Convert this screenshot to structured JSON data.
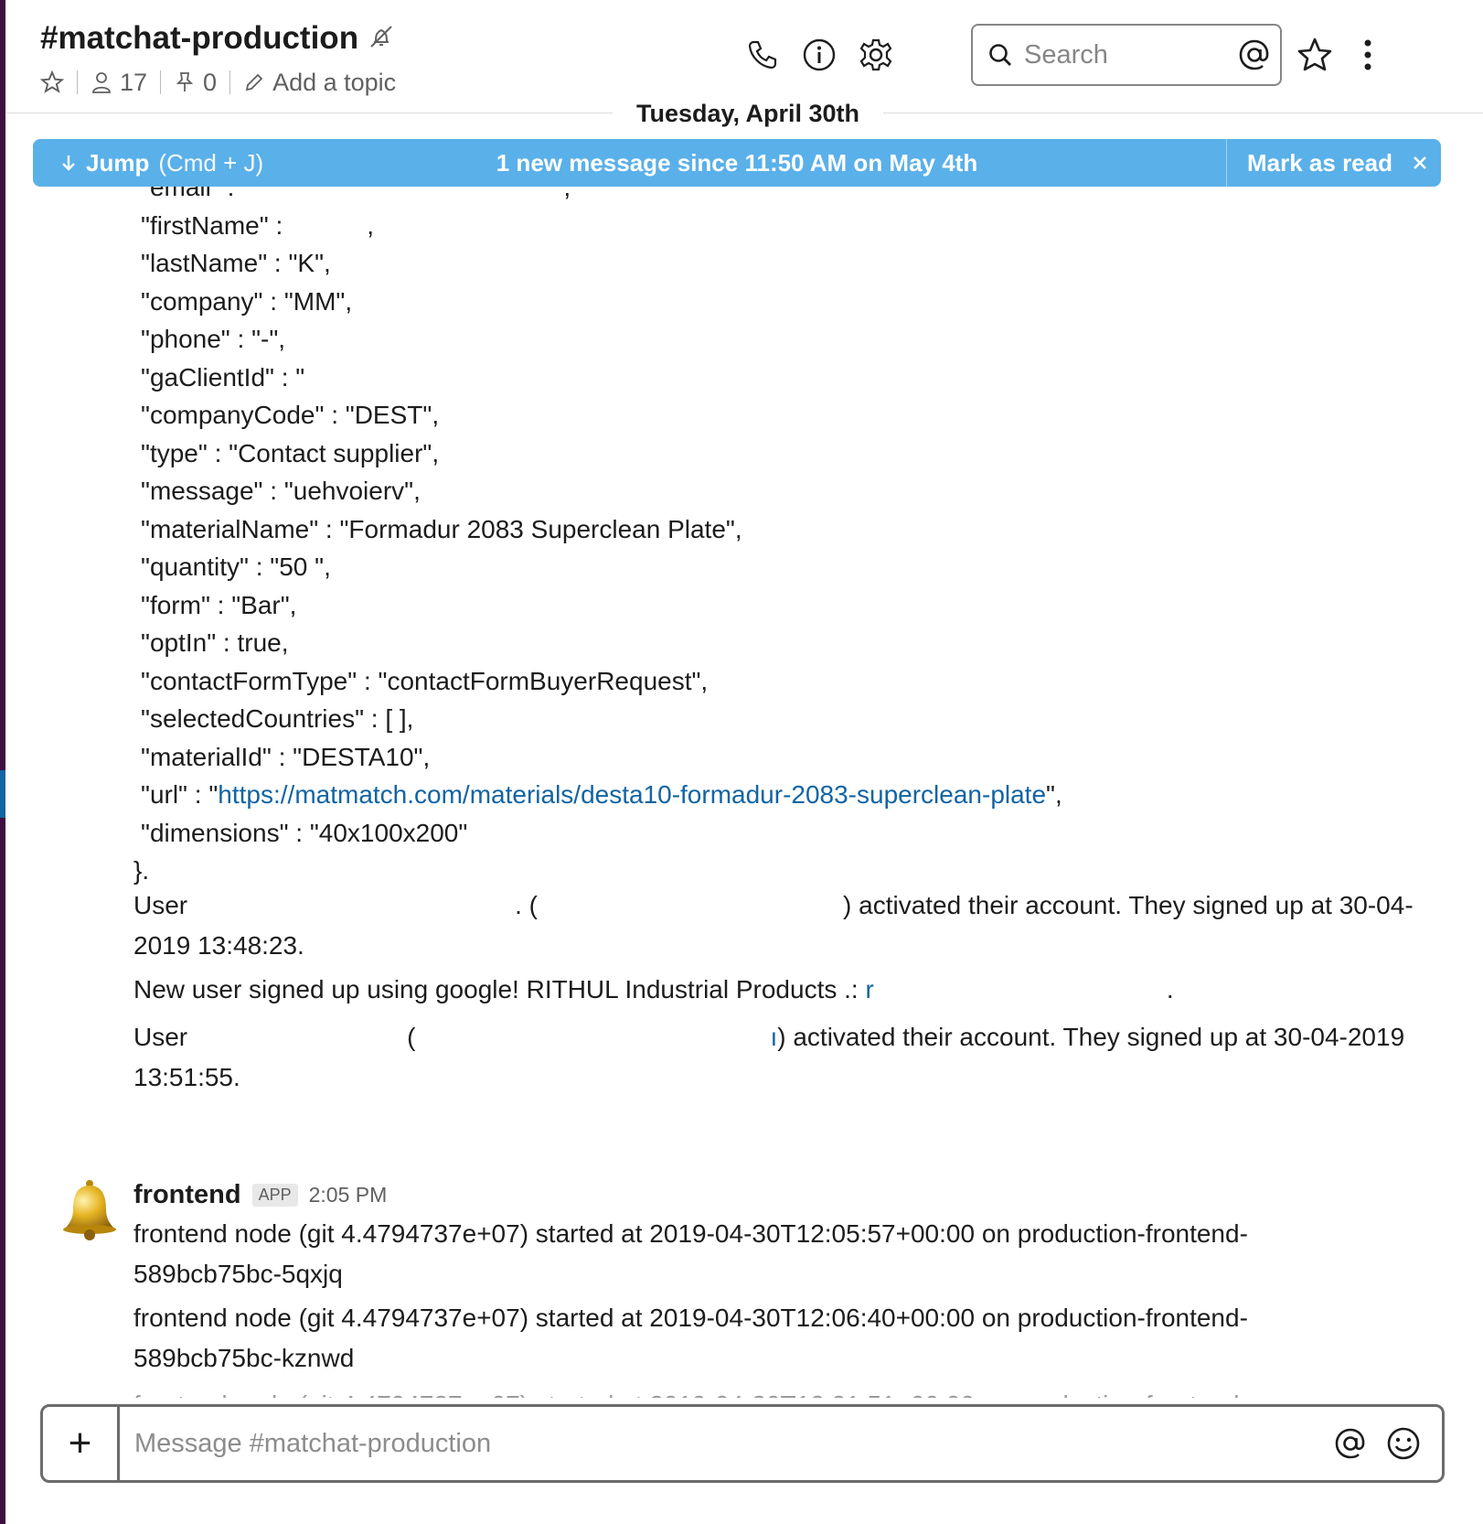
{
  "header": {
    "channel_name": "#matchat-production",
    "member_count": "17",
    "pinned_count": "0",
    "add_topic_label": "Add a topic",
    "search_placeholder": "Search"
  },
  "date_divider": "Tuesday, April 30th",
  "jump_banner": {
    "jump_label": "Jump",
    "jump_hint": "(Cmd + J)",
    "new_messages_text": "1 new message since 11:50 AM on May 4th",
    "mark_as_read_label": "Mark as read"
  },
  "json_lines": [
    "\"email\" :",
    "\"firstName\" :",
    "\"lastName\" : \"K\",",
    "\"company\" : \"MM\",",
    "\"phone\" : \"-\",",
    "\"gaClientId\" : \"",
    "\"companyCode\" : \"DEST\",",
    "\"type\" : \"Contact supplier\",",
    "\"message\" : \"uehvoierv\",",
    "\"materialName\" : \"Formadur 2083 Superclean Plate\",",
    "\"quantity\" : \"50 \",",
    "\"form\" : \"Bar\",",
    "\"optIn\" : true,",
    "\"contactFormType\" : \"contactFormBuyerRequest\",",
    "\"selectedCountries\" : [ ],",
    "\"materialId\" : \"DESTA10\","
  ],
  "url_line": {
    "prefix": "\"url\" : \"",
    "link": "https://matmatch.com/materials/desta10-formadur-2083-superclean-plate",
    "suffix": "\","
  },
  "dimensions_line": "\"dimensions\" : \"40x100x200\"",
  "json_close": "}.",
  "system_messages": {
    "activation_1_start": "User",
    "activation_1_mid": ". (",
    "activation_1_end": ") activated their account. They signed up at 30-04-2019 13:48:23.",
    "google_signup": "New user signed up using google! RITHUL Industrial Products .:",
    "google_signup_link": "r",
    "activation_2_start": "User",
    "activation_2_paren": "(",
    "activation_2_link": "ı",
    "activation_2_end": ") activated their account. They signed up at 30-04-2019 13:51:55."
  },
  "frontend_message": {
    "sender": "frontend",
    "badge": "APP",
    "time": "2:05 PM",
    "lines": [
      "frontend node (git 4.4794737e+07) started at 2019-04-30T12:05:57+00:00 on production-frontend-589bcb75bc-5qxjq",
      "frontend node (git 4.4794737e+07) started at 2019-04-30T12:06:40+00:00 on production-frontend-589bcb75bc-kznwd"
    ]
  },
  "composer": {
    "placeholder": "Message #matchat-production",
    "plus_label": "+"
  },
  "colors": {
    "banner": "#5ab0e9",
    "link": "#1264a3",
    "sidebar": "#3f0e40"
  }
}
